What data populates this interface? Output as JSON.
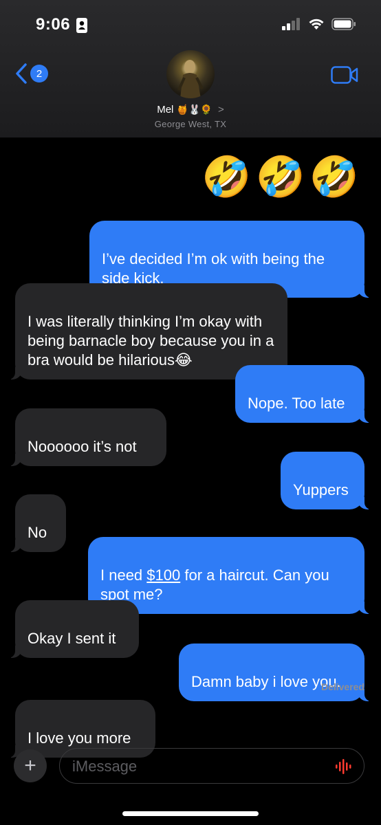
{
  "status_bar": {
    "time": "9:06"
  },
  "header": {
    "back_badge": "2",
    "contact_name": "Mel",
    "contact_emojis": "🍯🐰🌻",
    "contact_chevron": ">",
    "location": "George West, TX"
  },
  "messages": [
    {
      "side": "sent",
      "text": "🤣🤣🤣"
    },
    {
      "side": "sent",
      "text": "I’ve decided I’m ok with being the side kick."
    },
    {
      "side": "received",
      "text": "I was literally thinking I’m okay with being barnacle boy because you in a bra would be hilarious😂"
    },
    {
      "side": "sent",
      "text": "Nope. Too late"
    },
    {
      "side": "received",
      "text": "Noooooo it’s not"
    },
    {
      "side": "sent",
      "text": "Yuppers"
    },
    {
      "side": "received",
      "text": "No"
    },
    {
      "side": "sent",
      "text_before": "I need ",
      "link": "$100",
      "text_after": " for a haircut. Can you spot me?"
    },
    {
      "side": "received",
      "text": "Okay I sent it"
    },
    {
      "side": "sent",
      "text": "Damn baby i love you."
    },
    {
      "side": "received",
      "text": "I love you more"
    }
  ],
  "delivered_label": "Delivered",
  "composer": {
    "placeholder": "iMessage",
    "plus_label": "+"
  },
  "colors": {
    "sent_bubble": "#2f7cf6",
    "received_bubble": "#262628",
    "background": "#000000",
    "audio_icon": "#ff3b30"
  }
}
